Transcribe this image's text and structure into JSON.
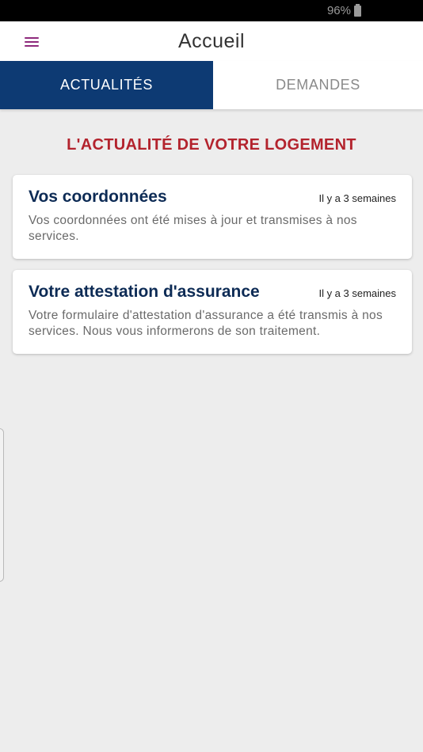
{
  "status_bar": {
    "battery": "96%",
    "battery_icon": "battery-icon"
  },
  "app_bar": {
    "title": "Accueil",
    "menu_icon": "hamburger-menu-icon",
    "accent": "#8e2a7c"
  },
  "tabs": [
    {
      "label": "ACTUALITÉS",
      "active": true
    },
    {
      "label": "DEMANDES",
      "active": false
    }
  ],
  "section": {
    "title": "L'ACTUALITÉ DE VOTRE LOGEMENT",
    "color": "#b3232d"
  },
  "news": [
    {
      "title": "Vos coordonnées",
      "time": "Il y a 3 semaines",
      "body": "Vos coordonnées ont été mises à jour et transmises à nos services."
    },
    {
      "title": "Votre attestation d'assurance",
      "time": "Il y a 3 semaines",
      "body": "Votre formulaire d'attestation d'assurance a été transmis à nos services. Nous vous informerons de son traitement."
    }
  ],
  "colors": {
    "primary": "#0d3a73",
    "background": "#ededed"
  }
}
